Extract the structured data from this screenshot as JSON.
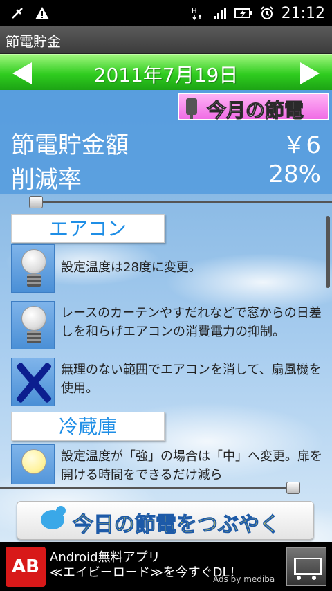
{
  "status_bar": {
    "time": "21:12",
    "icons": [
      "usb-debug-icon",
      "warning-icon",
      "hspa-icon",
      "signal-icon",
      "battery-charging-icon",
      "alarm-icon"
    ]
  },
  "app": {
    "title": "節電貯金"
  },
  "date_bar": {
    "date": "2011年7月19日"
  },
  "month_button": {
    "label": "今月の節電"
  },
  "stats": {
    "savings_label": "節電貯金額",
    "savings_value": "￥6",
    "reduction_label": "削減率",
    "reduction_value": "28%"
  },
  "sections": [
    {
      "title": "エアコン",
      "items": [
        {
          "icon": "bulb-off-icon",
          "text": "設定温度は28度に変更。"
        },
        {
          "icon": "bulb-off-icon",
          "text": "レースのカーテンやすだれなどで窓からの日差しを和らげエアコンの消費電力の抑制。"
        },
        {
          "icon": "cross-mark-icon",
          "text": "無理のない範囲でエアコンを消して、扇風機を使用。"
        }
      ]
    },
    {
      "title": "冷蔵庫",
      "items": [
        {
          "icon": "bulb-lit-icon",
          "text": "設定温度が「強」の場合は「中」へ変更。扉を開ける時間をできるだけ減ら"
        }
      ]
    }
  ],
  "tweet_button": {
    "label": "今日の節電をつぶやく"
  },
  "ad": {
    "logo": "AB",
    "line1": "Android無料アプリ",
    "line2": "≪エイビーロード≫を今すぐDL！",
    "by": "Ads by mediba"
  },
  "colors": {
    "date_bar": "#2fcc1f",
    "panel": "#549bde",
    "month_button": "#f06ce5",
    "section_title": "#1e8ee6",
    "tweet_text": "#ffe640",
    "ad_logo": "#d81919"
  }
}
